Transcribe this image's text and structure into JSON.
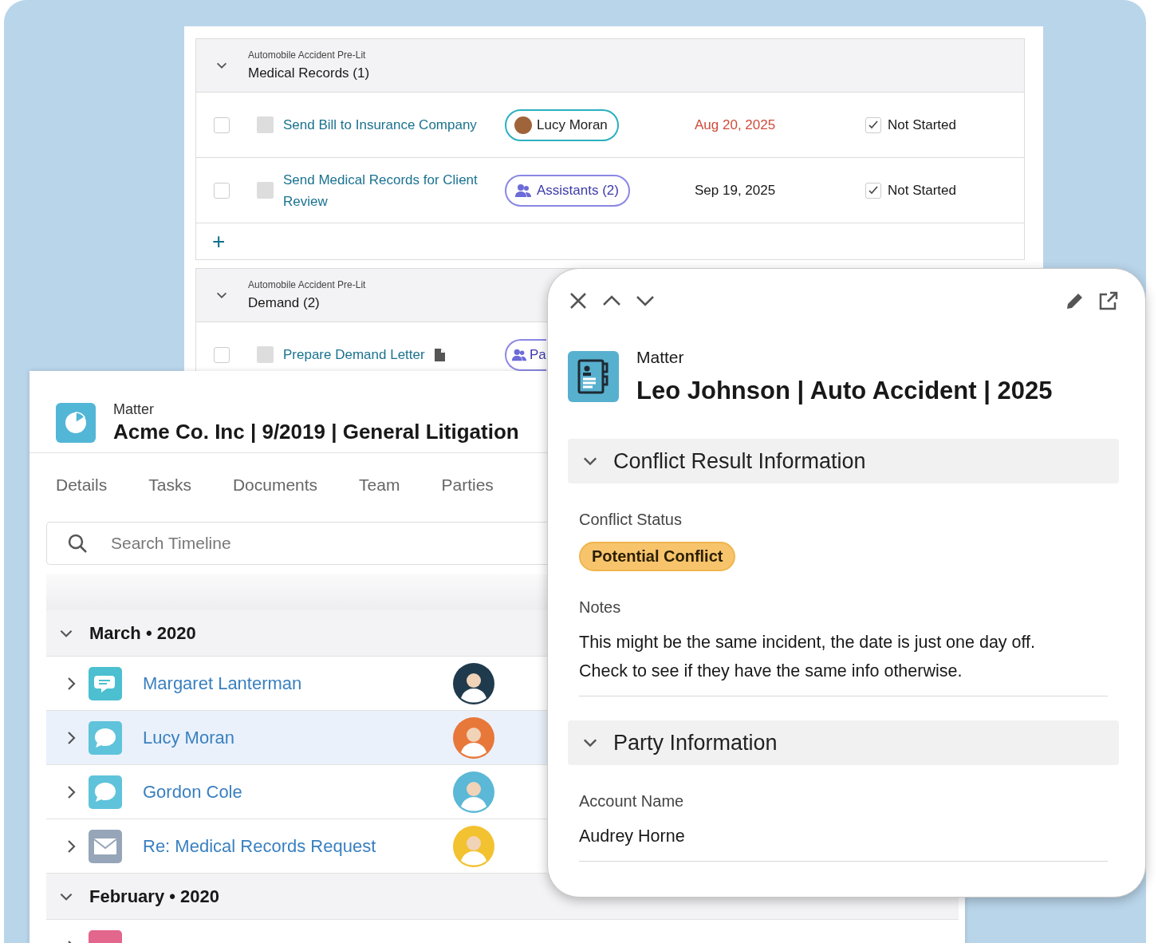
{
  "task_panel": {
    "groups": [
      {
        "category": "Automobile Accident Pre-Lit",
        "title": "Medical Records (1)",
        "expanded": true,
        "add_button": "+",
        "tasks": [
          {
            "checked": false,
            "name": "Send Bill to Insurance Company",
            "has_document": false,
            "assignee": {
              "kind": "person",
              "label": "Lucy Moran"
            },
            "due": "Aug 20, 2025",
            "overdue": true,
            "status_checked": true,
            "status": "Not Started"
          },
          {
            "checked": false,
            "name": "Send Medical Records for Client Review",
            "has_document": false,
            "assignee": {
              "kind": "group",
              "label": "Assistants (2)"
            },
            "due": "Sep 19, 2025",
            "overdue": false,
            "status_checked": true,
            "status": "Not Started"
          }
        ]
      },
      {
        "category": "Automobile Accident Pre-Lit",
        "title": "Demand (2)",
        "expanded": true,
        "tasks": [
          {
            "checked": false,
            "name": "Prepare Demand Letter",
            "has_document": true,
            "assignee": {
              "kind": "group",
              "label": "Pa"
            }
          }
        ]
      }
    ]
  },
  "matter_panel": {
    "object_label": "Matter",
    "title": "Acme Co. Inc | 9/2019 | General Litigation",
    "tabs": [
      {
        "label": "Details",
        "selected": false
      },
      {
        "label": "Tasks",
        "selected": false
      },
      {
        "label": "Documents",
        "selected": false
      },
      {
        "label": "Team",
        "selected": false
      },
      {
        "label": "Parties",
        "selected": false
      }
    ],
    "search": {
      "placeholder": "Search Timeline"
    },
    "timeline": [
      {
        "label": "March • 2020",
        "expanded": true,
        "items": [
          {
            "kind": "chat",
            "title": "Margaret Lanterman",
            "selected": false,
            "color": "#1f3a4d"
          },
          {
            "kind": "message",
            "title": "Lucy Moran",
            "selected": true,
            "color": "#e8773a"
          },
          {
            "kind": "message",
            "title": "Gordon Cole",
            "selected": false,
            "color": "#5bb8d6"
          },
          {
            "kind": "email",
            "title": "Re: Medical Records Request",
            "selected": false,
            "color": "#f2c230"
          }
        ]
      },
      {
        "label": "February • 2020",
        "expanded": true,
        "items": [
          {
            "kind": "event",
            "selected": false
          }
        ]
      }
    ]
  },
  "record_panel": {
    "object_label": "Matter",
    "title": "Leo Johnson | Auto Accident | 2025",
    "sections": [
      {
        "title": "Conflict Result Information",
        "expanded": true,
        "fields": [
          {
            "kind": "badge",
            "label": "Conflict Status",
            "value": "Potential Conflict"
          },
          {
            "kind": "text",
            "label": "Notes",
            "value": "This might be the same incident, the date is just one day off. Check to see if they have the same info otherwise."
          }
        ]
      },
      {
        "title": "Party Information",
        "expanded": true,
        "fields": [
          {
            "kind": "text",
            "label": "Account Name",
            "value": "Audrey Horne"
          }
        ]
      }
    ]
  }
}
